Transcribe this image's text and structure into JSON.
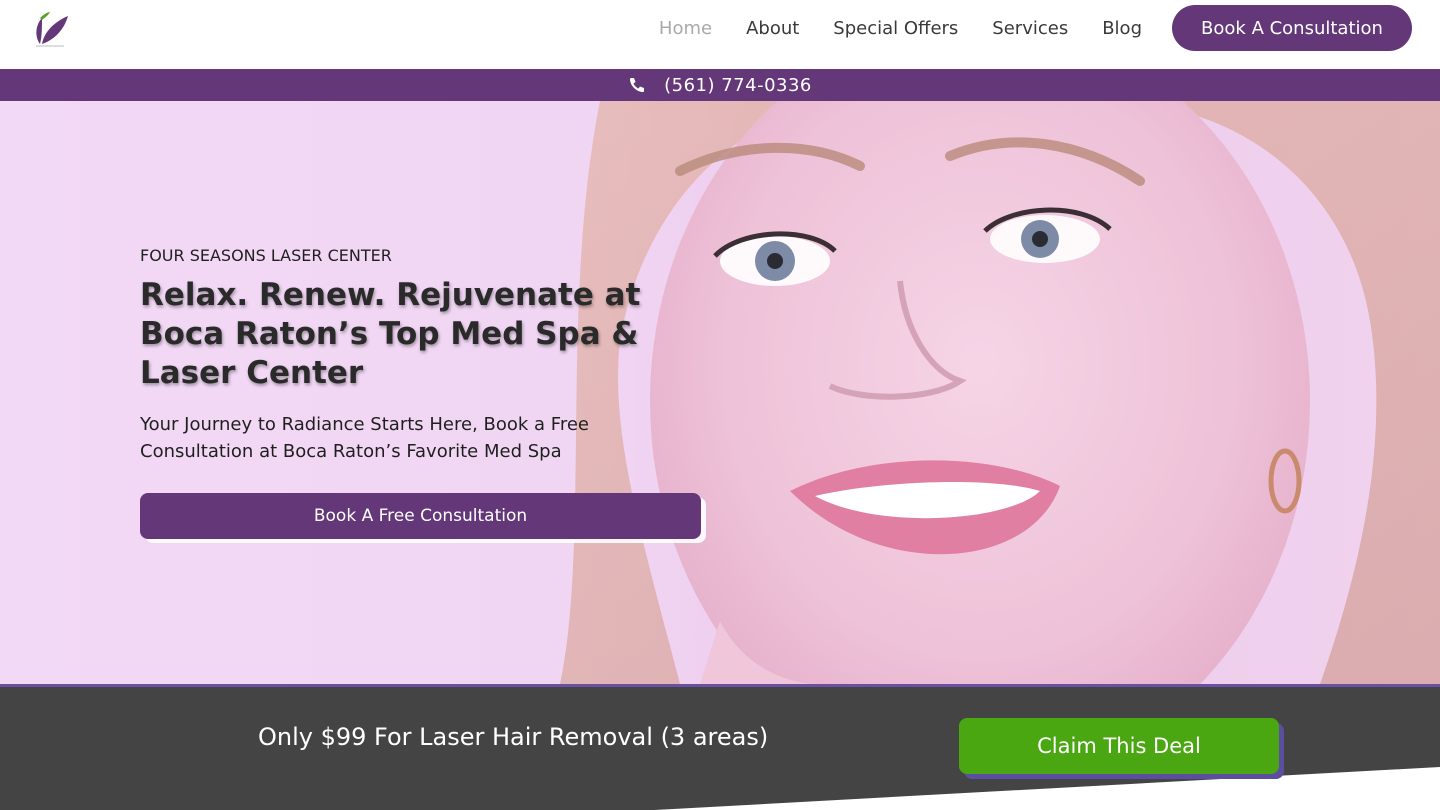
{
  "header": {
    "nav": [
      {
        "label": "Home",
        "active": true
      },
      {
        "label": "About"
      },
      {
        "label": "Special Offers"
      },
      {
        "label": "Services"
      },
      {
        "label": "Blog"
      }
    ],
    "cta_label": "Book A Consultation",
    "logo_icon": "leaf-logo-icon"
  },
  "phonebar": {
    "phone": "(561) 774-0336",
    "icon": "phone-icon"
  },
  "hero": {
    "eyebrow": "FOUR SEASONS LASER CENTER",
    "title": "Relax. Renew. Rejuvenate at Boca Raton’s Top Med Spa & Laser Center",
    "subtitle": "Your Journey to Radiance Starts Here, Book a Free Consultation at Boca Raton’s Favorite Med Spa",
    "cta_label": "Book A Free Consultation"
  },
  "deal": {
    "text": "Only $99 For Laser Hair Removal (3 areas)",
    "cta_label": "Claim This Deal"
  },
  "colors": {
    "brand_purple": "#643779",
    "deal_green": "#4aa712",
    "deal_bg": "#444444",
    "hero_tint": "#f2d9f5"
  }
}
